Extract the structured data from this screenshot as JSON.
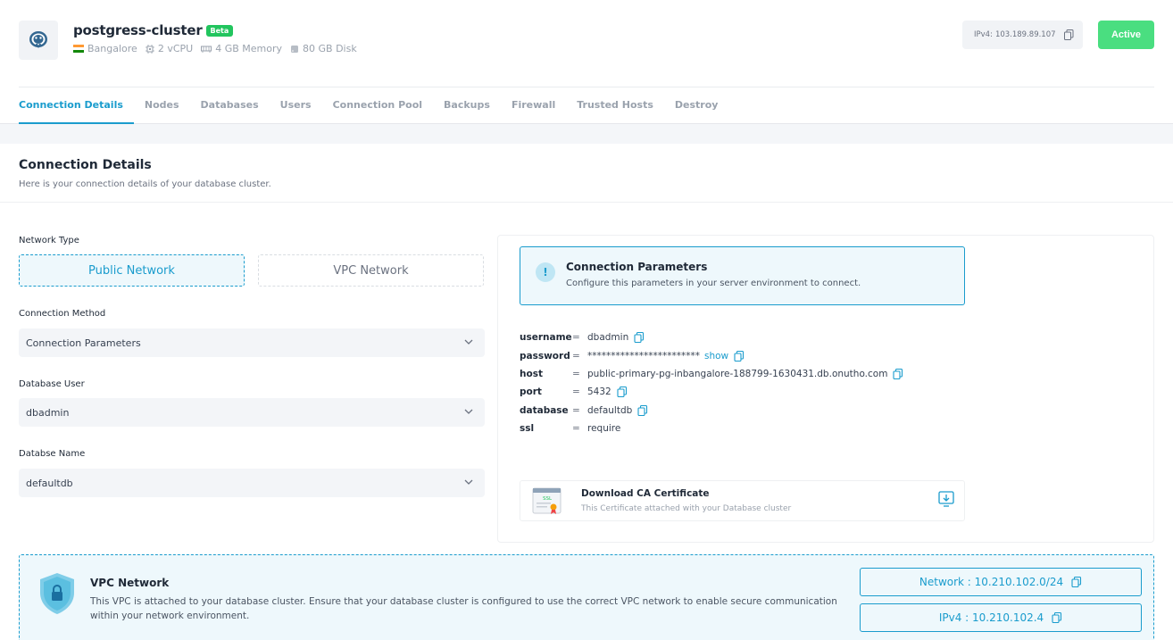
{
  "cluster": {
    "name": "postgress-cluster",
    "badge": "Beta",
    "location": "Bangalore",
    "cpu": "2 vCPU",
    "memory": "4 GB Memory",
    "disk": "80 GB Disk",
    "ipv4_label": "IPv4:",
    "ipv4": "103.189.89.107",
    "status": "Active"
  },
  "tabs": [
    {
      "label": "Connection Details",
      "active": true
    },
    {
      "label": "Nodes"
    },
    {
      "label": "Databases"
    },
    {
      "label": "Users"
    },
    {
      "label": "Connection Pool"
    },
    {
      "label": "Backups"
    },
    {
      "label": "Firewall"
    },
    {
      "label": "Trusted Hosts"
    },
    {
      "label": "Destroy"
    }
  ],
  "card": {
    "title": "Connection Details",
    "subtitle": "Here is your connection details of your database cluster."
  },
  "form": {
    "network_type_label": "Network Type",
    "public_network": "Public Network",
    "vpc_network": "VPC Network",
    "connection_method_label": "Connection Method",
    "connection_method_value": "Connection Parameters",
    "database_user_label": "Database User",
    "database_user_value": "dbadmin",
    "database_name_label": "Databse Name",
    "database_name_value": "defaultdb"
  },
  "info": {
    "icon": "!",
    "title": "Connection Parameters",
    "subtitle": "Configure this parameters in your server environment to connect."
  },
  "params": {
    "equals": "=",
    "username_key": "username",
    "username_val": "dbadmin",
    "password_key": "password",
    "password_val": "************************",
    "password_show": "show",
    "host_key": "host",
    "host_val": "public-primary-pg-inbangalore-188799-1630431.db.onutho.com",
    "port_key": "port",
    "port_val": "5432",
    "database_key": "database",
    "database_val": "defaultdb",
    "ssl_key": "ssl",
    "ssl_val": "require"
  },
  "certificate": {
    "title": "Download CA Certificate",
    "subtitle": "This Certificate attached with your Database cluster",
    "badge": "SSL"
  },
  "vpc": {
    "title": "VPC Network",
    "description": "This VPC is attached to your database cluster. Ensure that your database cluster is configured to use the correct VPC network to enable secure communication within your network environment.",
    "network": "Network : 10.210.102.0/24",
    "ipv4": "IPv4 : 10.210.102.4"
  },
  "colors": {
    "accent": "#1a9ccd",
    "active_green": "#4ade80",
    "beta_green": "#22c55e"
  },
  "icons": [
    "postgresql-logo-icon",
    "india-flag-icon",
    "cpu-icon",
    "memory-icon",
    "disk-icon",
    "copy-icon",
    "info-icon",
    "chevron-down-icon",
    "certificate-icon",
    "download-icon",
    "shield-lock-icon"
  ]
}
